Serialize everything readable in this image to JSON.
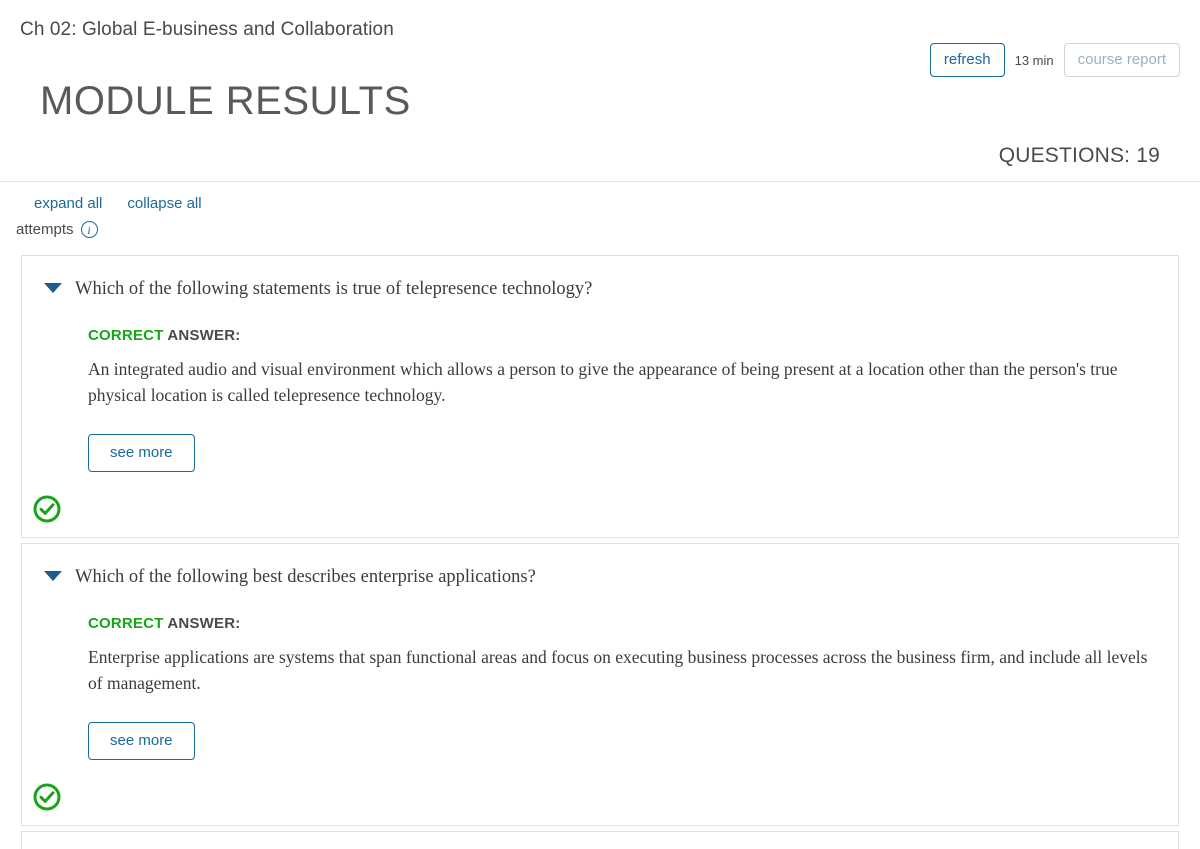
{
  "header": {
    "breadcrumb_title": "Ch 02: Global E-business and Collaboration",
    "refresh_label": "refresh",
    "time_label": "13 min",
    "course_report_label": "course report",
    "module_title": "MODULE RESULTS",
    "questions_count_label": "QUESTIONS: 19"
  },
  "controls": {
    "expand_all_label": "expand all",
    "collapse_all_label": "collapse all",
    "attempts_label": "attempts",
    "info_icon_glyph": "i",
    "info_icon_name": "info-icon"
  },
  "labels": {
    "correct_word": "CORRECT",
    "answer_word": " ANSWER:",
    "see_more_label": "see more"
  },
  "colors": {
    "link_blue": "#1b6a99",
    "correct_green": "#17a517",
    "caret_blue": "#1b5e88",
    "muted_border": "#c9d4dc",
    "card_border": "#e0e0e0"
  },
  "questions": [
    {
      "question": "Which of the following statements is true of telepresence technology?",
      "answer": "An integrated audio and visual environment which allows a person to give the appearance of being present at a location other than the person's true physical location is called telepresence technology.",
      "status": "correct"
    },
    {
      "question": "Which of the following best describes enterprise applications?",
      "answer": "Enterprise applications are systems that span functional areas and focus on executing business processes across the business firm, and include all levels of management.",
      "status": "correct"
    }
  ]
}
